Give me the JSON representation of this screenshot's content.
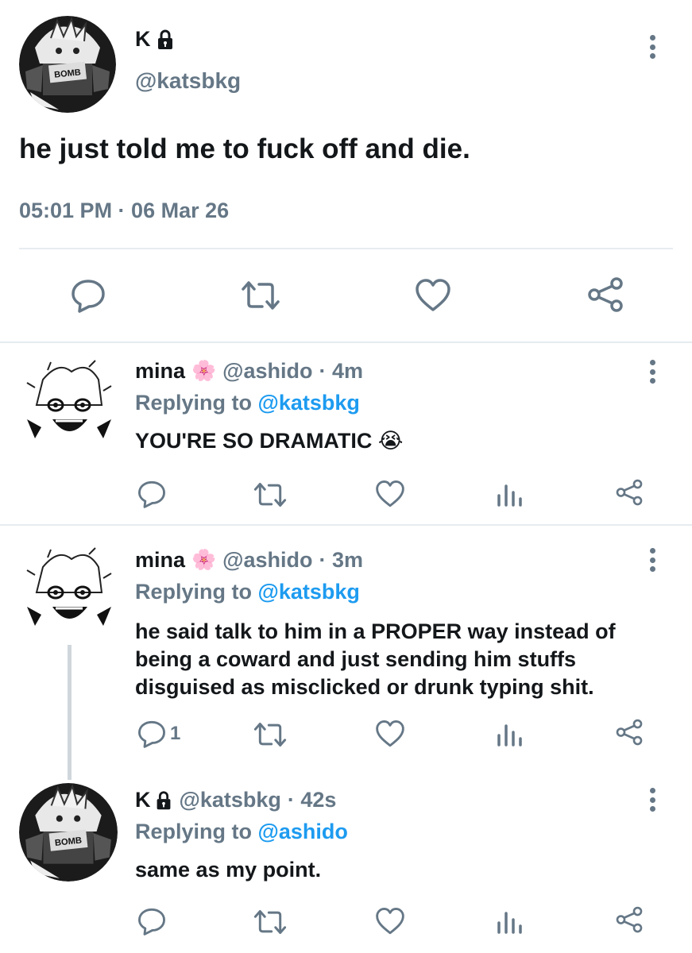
{
  "main_tweet": {
    "display_name": "K",
    "handle": "@katsbkg",
    "text": "he just told me to fuck off and die.",
    "timestamp": "05:01 PM · 06 Mar 26",
    "avatar_text": "BOMB",
    "icons": [
      "lock-icon",
      "more-icon",
      "reply-icon",
      "retweet-icon",
      "like-icon",
      "share-icon"
    ]
  },
  "replies": [
    {
      "display_name": "mina",
      "emoji": "🌸",
      "handle": "@ashido",
      "time": "· 4m",
      "replying_label": "Replying to",
      "replying_to": "@katsbkg",
      "text": "YOU'RE SO DRAMATIC 😭",
      "reply_count": ""
    },
    {
      "display_name": "mina",
      "emoji": "🌸",
      "handle": "@ashido",
      "time": "· 3m",
      "replying_label": "Replying to",
      "replying_to": "@katsbkg",
      "text_lines": [
        "he said talk to him in a PROPER way instead of",
        "being a coward and just sending him stuffs",
        "disguised as misclicked or drunk typing shit."
      ],
      "reply_count": "1"
    },
    {
      "display_name": "K",
      "handle": "@katsbkg",
      "time": "· 42s",
      "replying_label": "Replying to",
      "replying_to": "@ashido",
      "text": "same as my point.",
      "avatar_text": "BOMB",
      "reply_count": ""
    }
  ],
  "colors": {
    "link": "#1d9bf0",
    "muted": "#657786",
    "text": "#14171a",
    "divider": "#e6ecf0"
  }
}
